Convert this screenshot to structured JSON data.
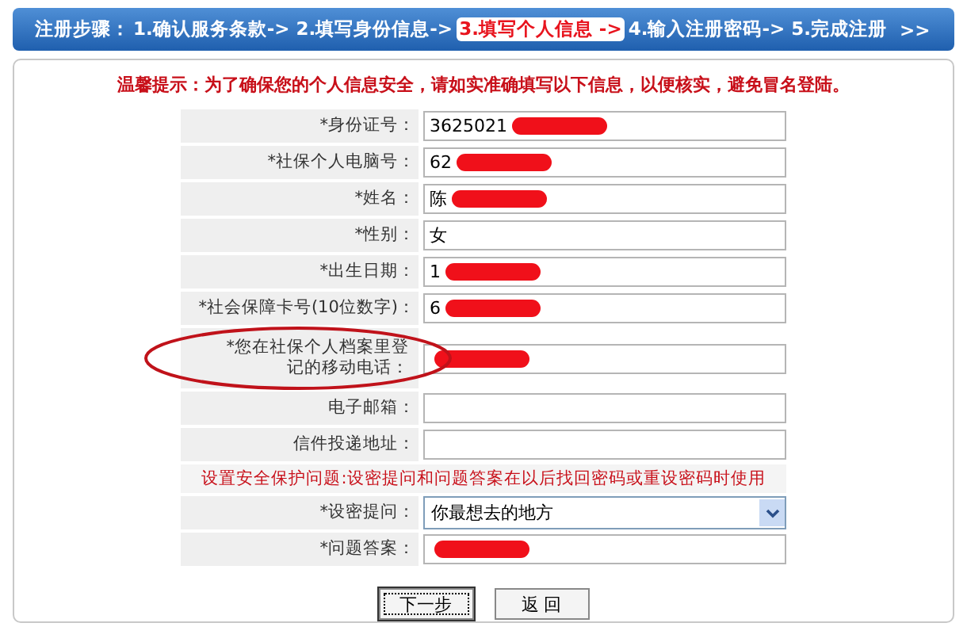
{
  "steps": {
    "prefix": "注册步骤：",
    "items": [
      {
        "label": "1.确认服务条款->",
        "selected": false
      },
      {
        "label": "2.填写身份信息->",
        "selected": false
      },
      {
        "label": "3.填写个人信息 ->",
        "selected": true
      },
      {
        "label": "4.输入注册密码->",
        "selected": false
      },
      {
        "label": "5.完成注册",
        "selected": false
      }
    ],
    "more": ">>"
  },
  "notice": "温馨提示：为了确保您的个人信息安全，请如实准确填写以下信息，以便核实，避免冒名登陆。",
  "fields": [
    {
      "kind": "input",
      "label": "*身份证号：",
      "value": "3625021",
      "redacted": true
    },
    {
      "kind": "input",
      "label": "*社保个人电脑号：",
      "value": "62",
      "redacted": true
    },
    {
      "kind": "input",
      "label": "*姓名：",
      "value": "陈",
      "redacted": true
    },
    {
      "kind": "input",
      "label": "*性别：",
      "value": "女",
      "redacted": false
    },
    {
      "kind": "input",
      "label": "*出生日期：",
      "value": "1",
      "redacted": true
    },
    {
      "kind": "input",
      "label": "*社会保障卡号(10位数字)：",
      "value": "6",
      "redacted": true
    },
    {
      "kind": "input",
      "label": "*您在社保个人档案里登记的移动电话：",
      "redacted": true,
      "circled": true
    },
    {
      "kind": "input",
      "label": "电子邮箱：",
      "redacted": false
    },
    {
      "kind": "input",
      "label": "信件投递地址：",
      "redacted": false
    },
    {
      "kind": "note",
      "label": "设置安全保护问题:设密提问和问题答案在以后找回密码或重设密码时使用"
    },
    {
      "kind": "select",
      "label": "*设密提问：",
      "value": "你最想去的地方"
    },
    {
      "kind": "input",
      "label": "*问题答案：",
      "redacted": true
    }
  ],
  "buttons": [
    {
      "label": "下一步",
      "focused": true
    },
    {
      "label": "返 回",
      "focused": false
    }
  ]
}
